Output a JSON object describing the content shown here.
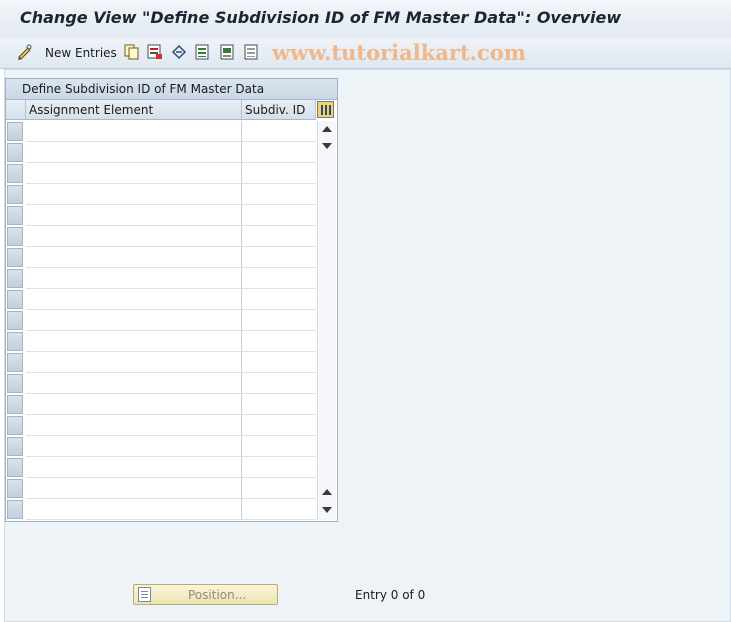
{
  "window": {
    "title": "Change View \"Define Subdivision ID of FM Master Data\": Overview"
  },
  "toolbar": {
    "new_entries_label": "New Entries",
    "icons": [
      "edit-glasses-icon",
      "copy-icon",
      "delete-icon",
      "undo-icon",
      "select-all-icon",
      "select-block-icon",
      "deselect-all-icon"
    ]
  },
  "watermark": "www.tutorialkart.com",
  "table": {
    "title": "Define Subdivision ID of FM Master Data",
    "columns": [
      "Assignment Element",
      "Subdiv. ID"
    ],
    "rows": [
      [
        "",
        ""
      ],
      [
        "",
        ""
      ],
      [
        "",
        ""
      ],
      [
        "",
        ""
      ],
      [
        "",
        ""
      ],
      [
        "",
        ""
      ],
      [
        "",
        ""
      ],
      [
        "",
        ""
      ],
      [
        "",
        ""
      ],
      [
        "",
        ""
      ],
      [
        "",
        ""
      ],
      [
        "",
        ""
      ],
      [
        "",
        ""
      ],
      [
        "",
        ""
      ],
      [
        "",
        ""
      ],
      [
        "",
        ""
      ],
      [
        "",
        ""
      ],
      [
        "",
        ""
      ],
      [
        "",
        ""
      ]
    ]
  },
  "footer": {
    "position_label": "Position...",
    "entry_text": "Entry 0 of 0"
  },
  "colors": {
    "title_text": "#1b2634",
    "toolbar_bg": "#dfe7f0",
    "content_bg": "#eef3f7",
    "position_button_bg": "#ece3b3",
    "watermark": "#f0b88a"
  }
}
